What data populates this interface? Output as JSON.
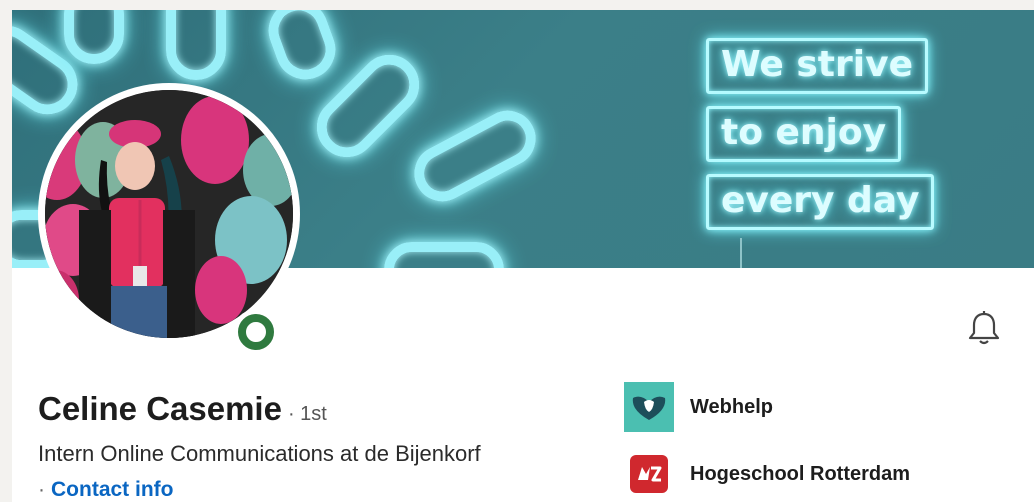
{
  "banner": {
    "sign_lines": [
      "We strive",
      "to enjoy",
      "every day"
    ],
    "neon_color": "#9ff6ff",
    "background_color": "#3a7c85"
  },
  "profile": {
    "name": "Celine Casemie",
    "degree": "· 1st",
    "headline": "Intern Online Communications at de Bijenkorf",
    "contact_bullet": "·",
    "contact_label": "Contact info",
    "status_color": "#2f7a3f"
  },
  "orgs": [
    {
      "name": "Webhelp",
      "icon": "webhelp-logo-icon",
      "color": "#4bbfb1"
    },
    {
      "name": "Hogeschool Rotterdam",
      "icon": "hogeschool-rotterdam-logo-icon",
      "color": "#d0282e"
    }
  ],
  "actions": {
    "notify_icon": "bell-icon"
  },
  "colors": {
    "link": "#0a66c2",
    "text": "#1d1d1d"
  }
}
